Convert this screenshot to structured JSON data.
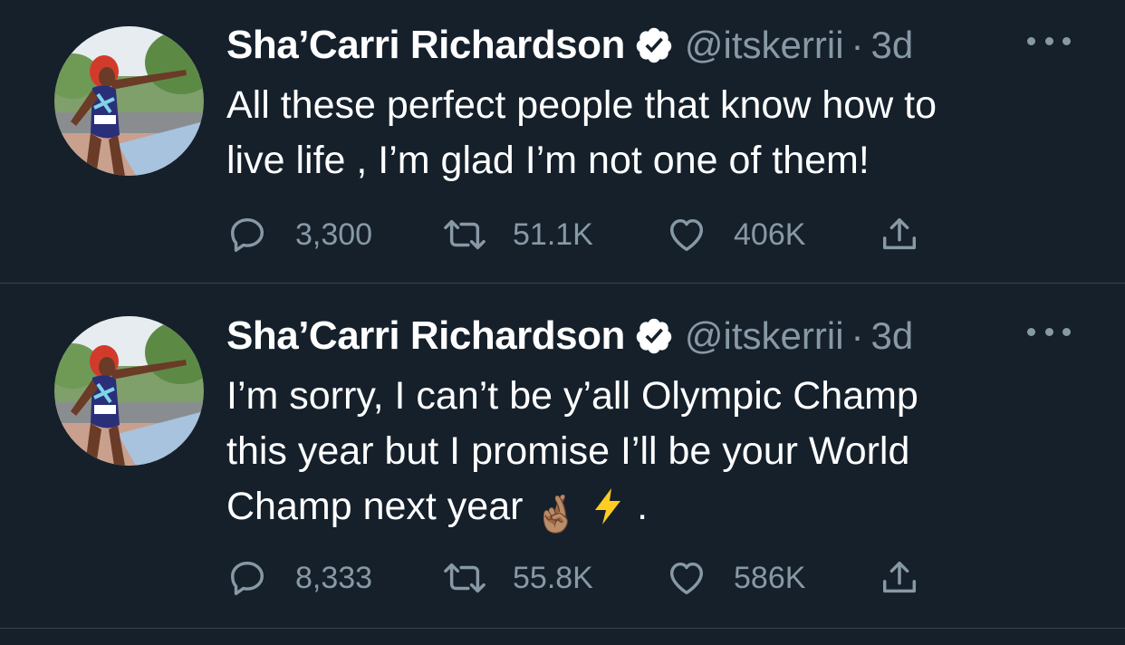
{
  "colors": {
    "background": "#15202b",
    "text_primary": "#ffffff",
    "text_secondary": "#8899a6",
    "divider": "#38444d",
    "verified_badge": "#ffffff"
  },
  "tweets": [
    {
      "display_name": "Sha’Carri Richardson",
      "verified_icon": "verified-badge-icon",
      "handle": "@itskerrii",
      "separator": "·",
      "time": "3d",
      "more_icon": "more-dots-icon",
      "text": "All these perfect people that know how to\nlive life , I’m glad I’m not one of them!",
      "replies": "3,300",
      "retweets": "51.1K",
      "likes": "406K",
      "share_icon": "share-icon"
    },
    {
      "display_name": "Sha’Carri Richardson",
      "verified_icon": "verified-badge-icon",
      "handle": "@itskerrii",
      "separator": "·",
      "time": "3d",
      "more_icon": "more-dots-icon",
      "text_line1": "I’m sorry, I can’t be y’all Olympic Champ",
      "text_line2": "this year but I promise I’ll be your World",
      "text_line3_pre": "Champ next year ",
      "emoji_1": "🤞🏽",
      "emoji_2": "⚡",
      "text_line3_post": " .",
      "replies": "8,333",
      "retweets": "55.8K",
      "likes": "586K",
      "share_icon": "share-icon"
    }
  ]
}
